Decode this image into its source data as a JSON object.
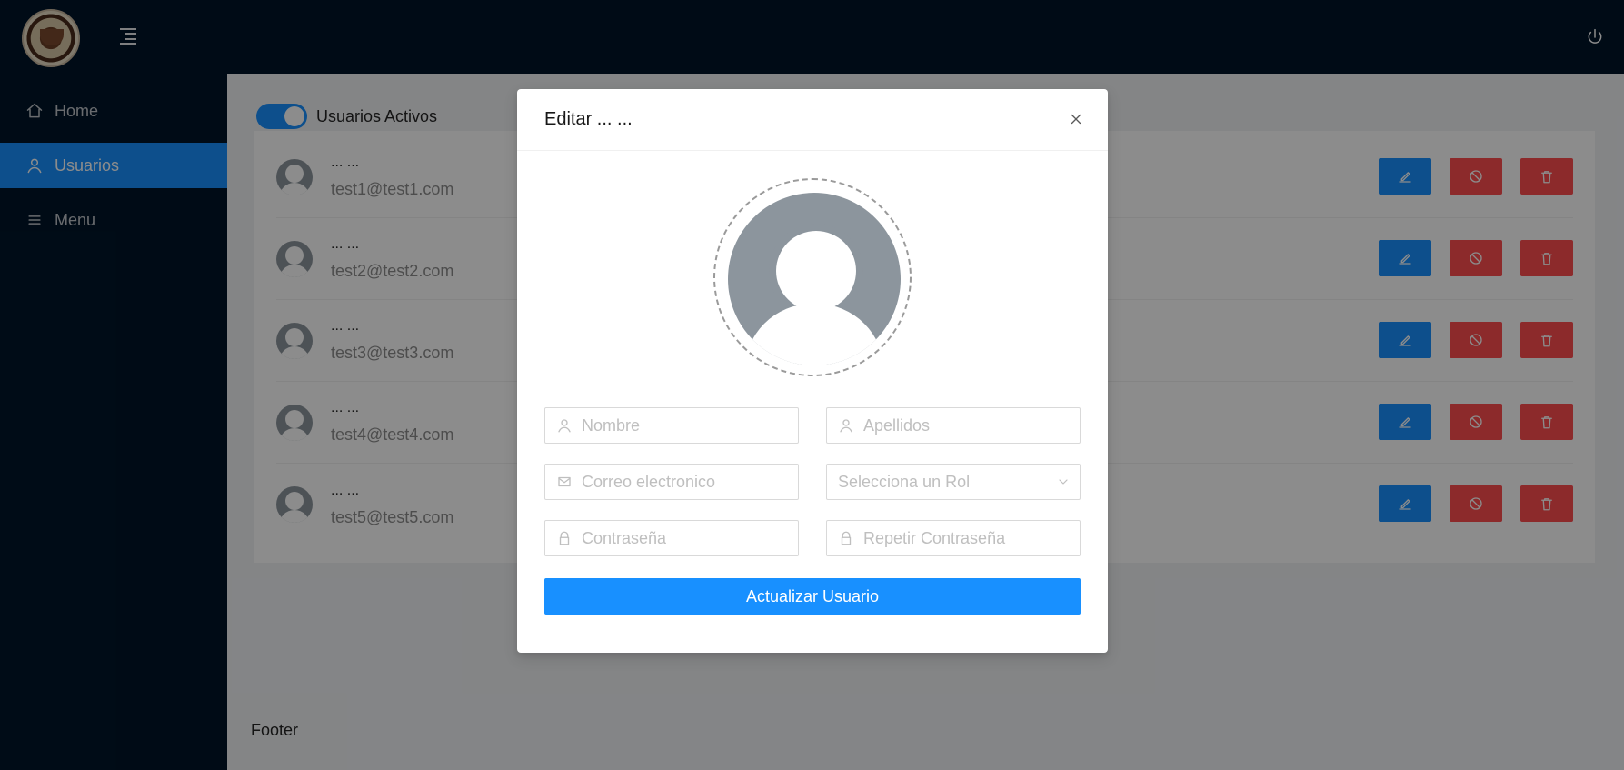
{
  "header": {
    "logo_name": "app-logo",
    "hamburger_icon": "menu-collapse-icon",
    "power_icon": "power-icon"
  },
  "sidebar": {
    "items": [
      {
        "label": "Home",
        "icon": "home-icon",
        "active": false
      },
      {
        "label": "Usuarios",
        "icon": "user-icon",
        "active": true
      },
      {
        "label": "Menu",
        "icon": "list-icon",
        "active": false
      }
    ]
  },
  "content": {
    "toggle_label": "Usuarios Activos",
    "footer": "Footer",
    "users": [
      {
        "name": "... ...",
        "email": "test1@test1.com"
      },
      {
        "name": "... ...",
        "email": "test2@test2.com"
      },
      {
        "name": "... ...",
        "email": "test3@test3.com"
      },
      {
        "name": "... ...",
        "email": "test4@test4.com"
      },
      {
        "name": "... ...",
        "email": "test5@test5.com"
      }
    ]
  },
  "modal": {
    "title": "Editar ... ...",
    "fields": {
      "nombre_placeholder": "Nombre",
      "apellidos_placeholder": "Apellidos",
      "correo_placeholder": "Correo electronico",
      "rol_placeholder": "Selecciona un Rol",
      "pass_placeholder": "Contraseña",
      "pass2_placeholder": "Repetir Contraseña"
    },
    "submit": "Actualizar Usuario"
  },
  "colors": {
    "sidebar": "#001529",
    "primary": "#1890ff",
    "danger": "#ff4d4f",
    "content": "#f0f2f5"
  }
}
